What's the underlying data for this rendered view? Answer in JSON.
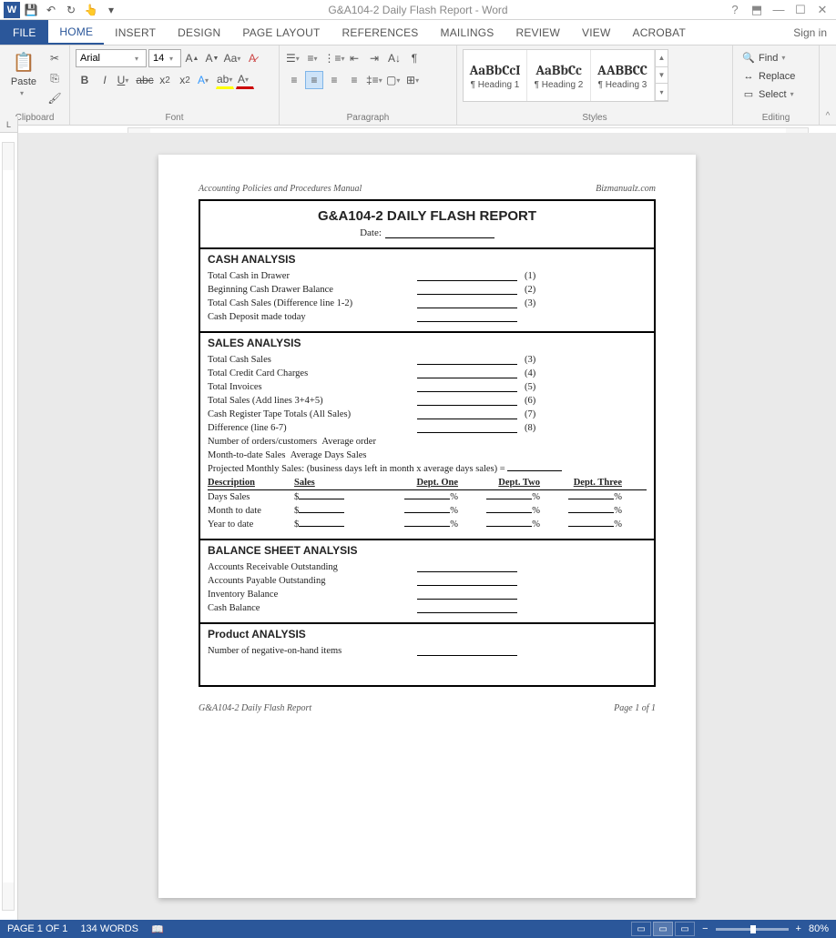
{
  "app": {
    "title": "G&A104-2 Daily Flash Report - Word",
    "signin": "Sign in"
  },
  "tabs": {
    "file": "FILE",
    "items": [
      "HOME",
      "INSERT",
      "DESIGN",
      "PAGE LAYOUT",
      "REFERENCES",
      "MAILINGS",
      "REVIEW",
      "VIEW",
      "ACROBAT"
    ],
    "active": 0
  },
  "ribbon": {
    "clipboard": {
      "paste": "Paste",
      "label": "Clipboard"
    },
    "font": {
      "name": "Arial",
      "size": "14",
      "label": "Font"
    },
    "paragraph": {
      "label": "Paragraph"
    },
    "styles": {
      "label": "Styles",
      "items": [
        {
          "preview": "AaBbCcI",
          "name": "¶ Heading 1"
        },
        {
          "preview": "AaBbCc",
          "name": "¶ Heading 2"
        },
        {
          "preview": "AABBCC",
          "name": "¶ Heading 3"
        }
      ]
    },
    "editing": {
      "label": "Editing",
      "find": "Find",
      "replace": "Replace",
      "select": "Select"
    }
  },
  "document": {
    "header_left": "Accounting Policies and Procedures Manual",
    "header_right": "Bizmanualz.com",
    "title": "G&A104-2 DAILY FLASH REPORT",
    "date_label": "Date:",
    "sections": {
      "cash": {
        "title": "CASH ANALYSIS",
        "rows": [
          {
            "label": "Total Cash in Drawer",
            "num": "(1)"
          },
          {
            "label": "Beginning Cash Drawer Balance",
            "num": "(2)"
          },
          {
            "label": "Total Cash Sales (Difference line 1-2)",
            "num": "(3)"
          },
          {
            "label": "Cash Deposit made today",
            "num": ""
          }
        ]
      },
      "sales": {
        "title": "SALES ANALYSIS",
        "rows": [
          {
            "label": "Total Cash Sales",
            "num": "(3)"
          },
          {
            "label": "Total Credit Card Charges",
            "num": "(4)"
          },
          {
            "label": "Total Invoices",
            "num": "(5)"
          },
          {
            "label": "Total Sales (Add lines 3+4+5)",
            "num": "(6)"
          },
          {
            "label": "Cash Register Tape Totals (All Sales)",
            "num": "(7)"
          },
          {
            "label": "Difference (line 6-7)",
            "num": "(8)"
          }
        ],
        "orders_label": "Number of orders/customers",
        "avg_order": "Average order",
        "mtd_sales": "Month-to-date Sales",
        "avg_days": "Average Days Sales",
        "projected": "Projected Monthly Sales: (business days left in month x average days sales) =",
        "table_headers": [
          "Description",
          "Sales",
          "Dept. One",
          "Dept. Two",
          "Dept. Three"
        ],
        "table_rows": [
          "Days Sales",
          "Month to date",
          "Year to date"
        ]
      },
      "balance": {
        "title": "BALANCE SHEET ANALYSIS",
        "rows": [
          "Accounts Receivable Outstanding",
          "Accounts Payable Outstanding",
          "Inventory Balance",
          "Cash Balance"
        ]
      },
      "product": {
        "title": "Product ANALYSIS",
        "row": "Number of negative-on-hand items"
      }
    },
    "footer_left": "G&A104-2 Daily Flash Report",
    "footer_right": "Page 1 of 1"
  },
  "status": {
    "page": "PAGE 1 OF 1",
    "words": "134 WORDS",
    "zoom": "80%"
  }
}
